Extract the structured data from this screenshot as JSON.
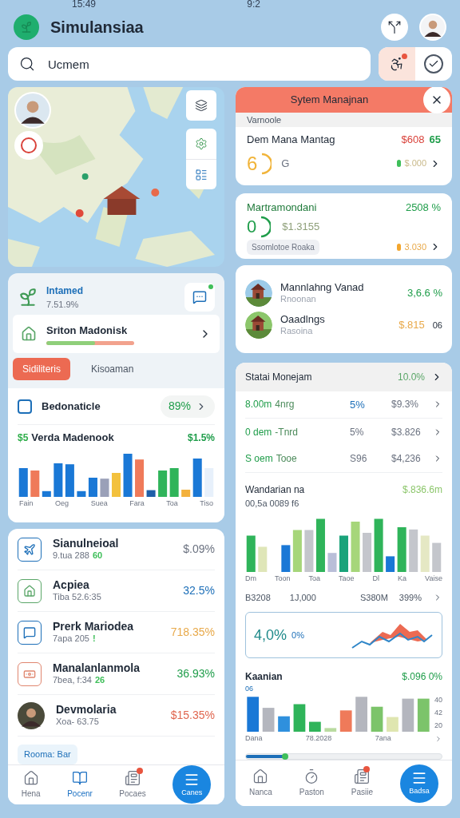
{
  "status_bar": {
    "time": "15:49",
    "center": "9:2"
  },
  "header": {
    "title": "Simulansiaa"
  },
  "search": {
    "placeholder": "Ucmem",
    "alert_selected": true
  },
  "left_panel": {
    "title": "Intamed",
    "subtitle": "7.51.9%",
    "card": {
      "title": "Sriton Madonisk",
      "level": 0.55
    },
    "tabs": [
      {
        "label": "Sidiliteris",
        "selected": true
      },
      {
        "label": "Kisoaman",
        "selected": false
      }
    ],
    "summary": {
      "title": "Bedonaticle",
      "value": "89%"
    },
    "chart": {
      "badge": "$5",
      "title": "Verda Madenook",
      "value": "$1.5%",
      "labels": [
        "Fain",
        "Oeg",
        "Suea",
        "Fara",
        "Toa",
        "Tiso"
      ]
    }
  },
  "list": [
    {
      "kind": "plane",
      "title": "Sianulneioal",
      "subtitle": "9.tua 288",
      "tag": "60",
      "value": "$.09%",
      "color": "#6b7280"
    },
    {
      "kind": "house",
      "title": "Acpiea",
      "subtitle": "Tiba 52.6:35",
      "value": "32.5%",
      "color": "#1d6fb8"
    },
    {
      "kind": "chat",
      "title": "Prerk Mariodea",
      "subtitle": "7apa 205",
      "tag": "!",
      "value": "718.35%",
      "color": "#e8a94a"
    },
    {
      "kind": "cash",
      "title": "Manalanlanmola",
      "subtitle": "7bea, f:34",
      "tag": "26",
      "value": "36.93%",
      "color": "#1f9d4a"
    },
    {
      "kind": "avatar",
      "title": "Devmolaria",
      "subtitle": "Xoa- 63.75",
      "value": "$15.35%",
      "color": "#e0664f"
    }
  ],
  "list_chip": "Rooma: Bar",
  "left_nav": [
    {
      "kind": "home",
      "label": "Hena",
      "selected": false,
      "badge": false
    },
    {
      "kind": "book",
      "label": "Pocenr",
      "selected": true,
      "badge": false
    },
    {
      "kind": "inbox",
      "label": "Pocaes",
      "selected": false,
      "badge": true
    },
    {
      "kind": "fab",
      "label": "Canes",
      "selected": false,
      "badge": false
    }
  ],
  "modal": {
    "title": "Sytem Manajnan",
    "section": "Varnoole",
    "item": {
      "title": "Dem Mana Mantag",
      "amount": "$608",
      "change": "65",
      "gauge": "6",
      "gauge_label": "G",
      "status": "$.000"
    }
  },
  "card2": {
    "title": "Martramondani",
    "value": "2508 %",
    "gauge": "0",
    "amount": "$1.3155",
    "chip": "Ssomlotoe Roaka",
    "status": "3.030"
  },
  "card3": [
    {
      "title": "Mannlahng Vanad",
      "subtitle": "Rnoonan",
      "value": "3,6.6 %",
      "color": "#1f9d4a"
    },
    {
      "title": "Oaadlngs",
      "subtitle": "Rasoina",
      "value": "$.815",
      "extra": "06",
      "color": "#e8a94a"
    }
  ],
  "right_panel": {
    "title": "Statai Monejam",
    "value": "10.0%",
    "rows": [
      {
        "name": "8.00m",
        "sub": "4nrg",
        "pct": "5%",
        "amount": "$9.3%",
        "highlight": true
      },
      {
        "name": "0 dem",
        "sub": "-Tnrd",
        "pct": "5%",
        "amount": "$3.826",
        "highlight": false
      },
      {
        "name": "S oem",
        "sub": "Tooe",
        "pct": "S96",
        "amount": "$4,236",
        "highlight": false
      }
    ],
    "section": {
      "title": "Wandarian na",
      "value": "$.836.6m",
      "subtitle": "00,5a 0089 f6",
      "labels": [
        "Dm",
        "Toon",
        "Toa",
        "Taoe",
        "Dl",
        "Ka",
        "Vaise"
      ]
    },
    "stats": [
      "B3208",
      "1J,000",
      "S380M",
      "399%"
    ],
    "trend": {
      "value": "4,0%",
      "unit": "0%"
    },
    "chart2": {
      "title": "Kaanian",
      "value": "$.096 0%",
      "top_label": "06",
      "axis": [
        "40",
        "42",
        "20"
      ],
      "labels": [
        "Dana",
        "78.2028",
        "7ana"
      ]
    },
    "slider": {
      "level": 0.2
    }
  },
  "right_nav": [
    {
      "kind": "home",
      "label": "Nanca",
      "selected": false,
      "badge": false
    },
    {
      "kind": "timer",
      "label": "Paston",
      "selected": false,
      "badge": false
    },
    {
      "kind": "inbox",
      "label": "Pasiie",
      "selected": false,
      "badge": true
    },
    {
      "kind": "fab",
      "label": "Badsa",
      "selected": false,
      "badge": false
    }
  ]
}
